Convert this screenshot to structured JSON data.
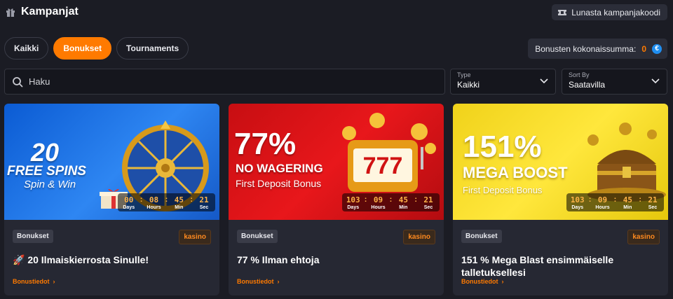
{
  "header": {
    "title": "Kampanjat",
    "redeem_label": "Lunasta kampanjakoodi"
  },
  "filters": [
    {
      "label": "Kaikki",
      "active": false
    },
    {
      "label": "Bonukset",
      "active": true
    },
    {
      "label": "Tournaments",
      "active": false
    }
  ],
  "total": {
    "label": "Bonusten kokonaissumma:",
    "amount": "0",
    "currency_icon": "euro-icon"
  },
  "search": {
    "placeholder": "Haku",
    "value": ""
  },
  "type_select": {
    "label": "Type",
    "value": "Kaikki"
  },
  "sort_select": {
    "label": "Sort By",
    "value": "Saatavilla"
  },
  "timer_caps": {
    "days": "Days",
    "hours": "Hours",
    "min": "Min",
    "sec": "Sec"
  },
  "cards": [
    {
      "banner": {
        "line1": "20",
        "line2": "FREE SPINS",
        "line3": "Spin & Win"
      },
      "timer": {
        "days": "00",
        "hours": "08",
        "min": "45",
        "sec": "21"
      },
      "category": "Bonukset",
      "tag": "kasino",
      "title": "🚀 20 Ilmaiskierrosta Sinulle!",
      "link": "Bonustiedot"
    },
    {
      "banner": {
        "line1": "77%",
        "line2": "NO WAGERING",
        "line3": "First Deposit Bonus",
        "reels": "777"
      },
      "timer": {
        "days": "103",
        "hours": "09",
        "min": "45",
        "sec": "21"
      },
      "category": "Bonukset",
      "tag": "kasino",
      "title": "77 % Ilman ehtoja",
      "link": "Bonustiedot"
    },
    {
      "banner": {
        "line1": "151%",
        "line2": "MEGA BOOST",
        "line3": "First Deposit Bonus"
      },
      "timer": {
        "days": "103",
        "hours": "09",
        "min": "45",
        "sec": "21"
      },
      "category": "Bonukset",
      "tag": "kasino",
      "title": "151 % Mega Blast ensimmäiselle talletuksellesi",
      "link": "Bonustiedot"
    }
  ],
  "colors": {
    "accent": "#ff7a00",
    "background": "#1b1c24",
    "card": "#262833"
  }
}
